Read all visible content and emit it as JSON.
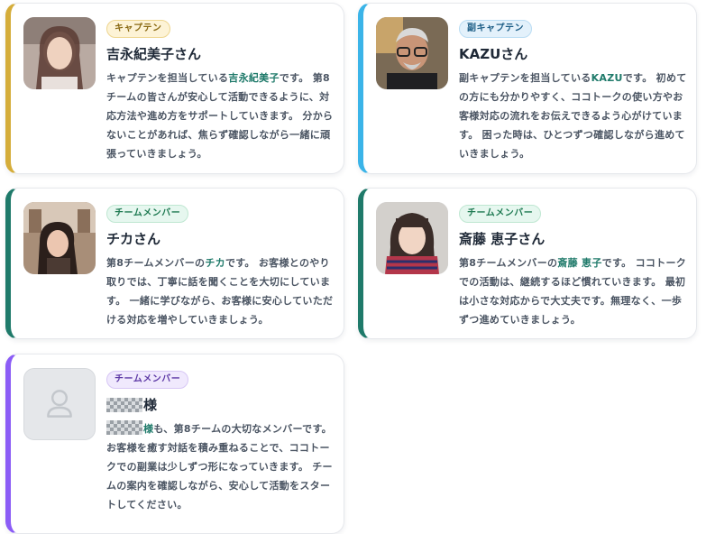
{
  "colors": {
    "captain_accent": "#d5ad3a",
    "vice_accent": "#3bb4e8",
    "member_accent": "#1f7a6a",
    "member_purple_accent": "#8b5cf6",
    "highlight": "#1f7a6a"
  },
  "cards": [
    {
      "badge": "キャプテン",
      "name": "吉永紀美子さん",
      "desc_pre": "キャプテンを担当している",
      "desc_hl": "吉永紀美子",
      "desc_post": "です。 第8チームの皆さんが安心して活動できるように、対応方法や進め方をサポートしていきます。 分からないことがあれば、焦らず確認しながら一緒に頑張っていきましょう。",
      "avatar_icon": "profile-photo"
    },
    {
      "badge": "副キャプテン",
      "name": "KAZUさん",
      "desc_pre": "副キャプテンを担当している",
      "desc_hl": "KAZU",
      "desc_post": "です。 初めての方にも分かりやすく、ココトークの使い方やお客様対応の流れをお伝えできるよう心がけています。 困った時は、ひとつずつ確認しながら進めていきましょう。",
      "avatar_icon": "profile-photo"
    },
    {
      "badge": "チームメンバー",
      "name": "チカさん",
      "desc_pre": "第8チームメンバーの",
      "desc_hl": "チカ",
      "desc_post": "です。 お客様とのやり取りでは、丁寧に話を聞くことを大切にしています。 一緒に学びながら、お客様に安心していただける対応を増やしていきましょう。",
      "avatar_icon": "profile-photo"
    },
    {
      "badge": "チームメンバー",
      "name": "斎藤 恵子さん",
      "desc_pre": "第8チームメンバーの",
      "desc_hl": "斎藤 恵子",
      "desc_post": "です。 ココトークでの活動は、継続するほど慣れていきます。 最初は小さな対応からで大丈夫です。無理なく、一歩ずつ進めていきましょう。",
      "avatar_icon": "profile-photo"
    },
    {
      "badge": "チームメンバー",
      "name_suffix": "様",
      "desc_hl_suffix": "様",
      "desc_post": "も、第8チームの大切なメンバーです。 お客様を癒す対話を積み重ねることで、ココトークでの副業は少しずつ形になっていきます。 チームの案内を確認しながら、安心して活動をスタートしてください。",
      "avatar_icon": "user-placeholder-icon"
    }
  ]
}
